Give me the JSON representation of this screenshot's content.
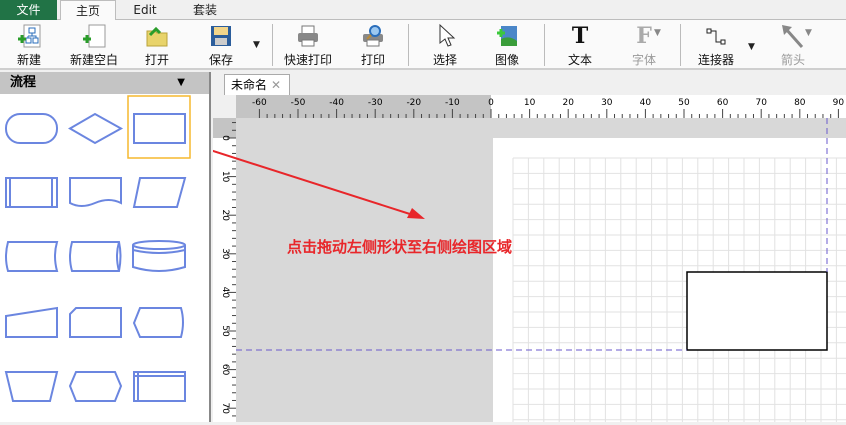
{
  "menu": {
    "file": "文件",
    "home": "主页",
    "edit": "Edit",
    "suite": "套装"
  },
  "toolbar": {
    "new": "新建",
    "new_blank": "新建空白",
    "open": "打开",
    "save": "保存",
    "quick_print": "快速打印",
    "print": "打印",
    "select": "选择",
    "image": "图像",
    "text": "文本",
    "font": "字体",
    "connector": "连接器",
    "arrow": "箭头"
  },
  "sidebar": {
    "title": "流程",
    "selected_shape": "process-rectangle"
  },
  "doc": {
    "tab": "未命名",
    "close": "✕"
  },
  "ruler": {
    "h_labels": [
      "-60",
      "-50",
      "-40",
      "-30",
      "-20",
      "-10",
      "0",
      "10",
      "20",
      "30",
      "40",
      "50",
      "60",
      "70",
      "80",
      "90"
    ],
    "v_labels": [
      "0",
      "10",
      "20",
      "30",
      "40",
      "50",
      "60",
      "70"
    ]
  },
  "annotation": {
    "text": "点击拖动左侧形状至右侧绘图区域",
    "color": "#e8262a"
  },
  "colors": {
    "shape_stroke": "#6b86e0",
    "selection": "#f5b82e",
    "guide": "#6a5acd"
  }
}
